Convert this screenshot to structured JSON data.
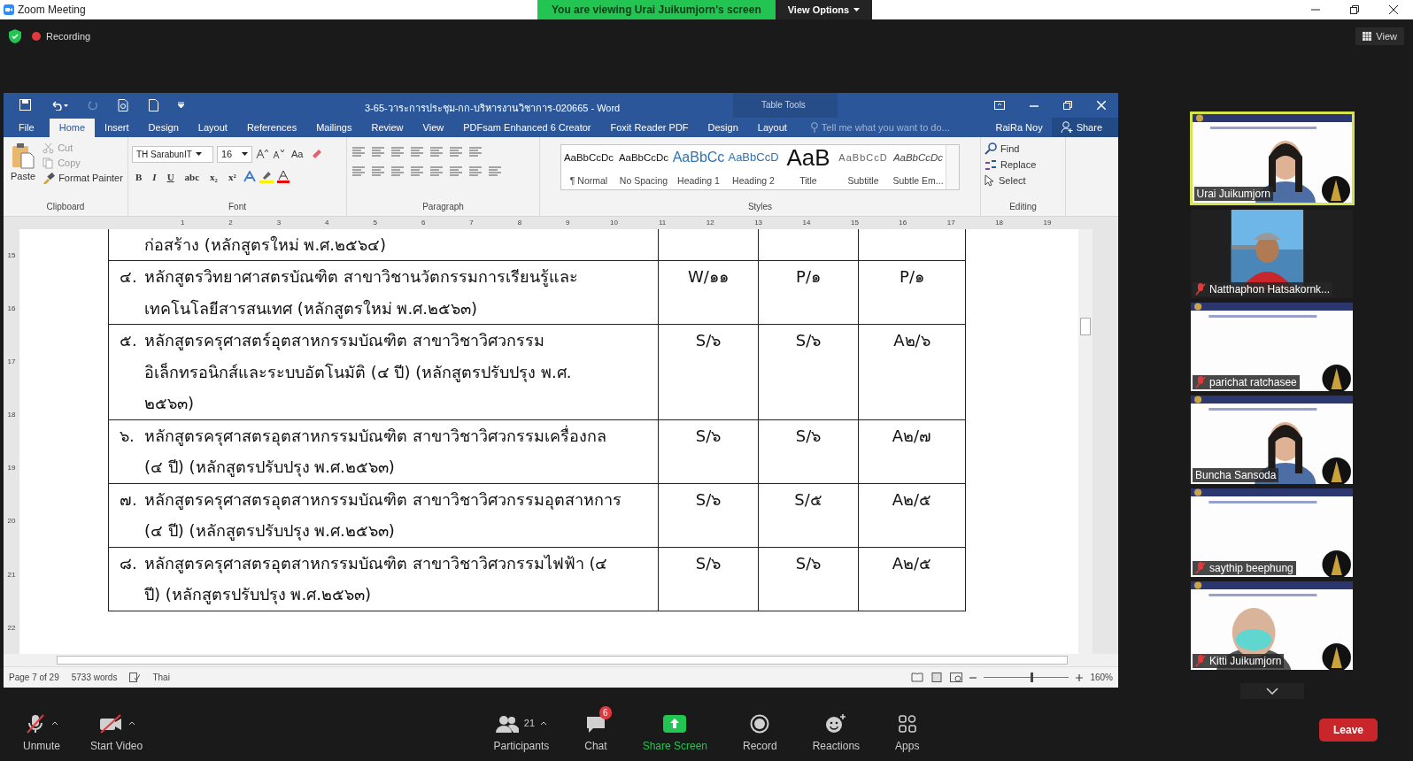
{
  "zoom": {
    "title": "Zoom Meeting",
    "banner": "You are viewing Urai Juikumjorn's screen",
    "view_options": "View Options",
    "recording": "Recording",
    "view": "View"
  },
  "word": {
    "title": "3-65-วาระการประชุม-กก-บริหารงานวิชาการ-020665 - Word",
    "context_label": "Table Tools",
    "tabs": [
      {
        "label": "File",
        "selected": false,
        "kind": "file"
      },
      {
        "label": "Home",
        "selected": true,
        "kind": "main"
      },
      {
        "label": "Insert",
        "selected": false,
        "kind": "main"
      },
      {
        "label": "Design",
        "selected": false,
        "kind": "main"
      },
      {
        "label": "Layout",
        "selected": false,
        "kind": "main"
      },
      {
        "label": "References",
        "selected": false,
        "kind": "main"
      },
      {
        "label": "Mailings",
        "selected": false,
        "kind": "main"
      },
      {
        "label": "Review",
        "selected": false,
        "kind": "main"
      },
      {
        "label": "View",
        "selected": false,
        "kind": "main"
      },
      {
        "label": "PDFsam Enhanced 6 Creator",
        "selected": false,
        "kind": "main"
      },
      {
        "label": "Foxit Reader PDF",
        "selected": false,
        "kind": "main"
      },
      {
        "label": "Design",
        "selected": false,
        "kind": "context"
      },
      {
        "label": "Layout",
        "selected": false,
        "kind": "context"
      }
    ],
    "tell_me": {
      "placeholder": "Tell me what you want to do..."
    },
    "user": "RaiRa Noy",
    "share": "Share",
    "clipboard": {
      "label": "Clipboard",
      "paste": "Paste",
      "items": [
        {
          "label": "Cut",
          "disabled": true,
          "kind": "cut"
        },
        {
          "label": "Copy",
          "disabled": true,
          "kind": "copy"
        },
        {
          "label": "Format Painter",
          "disabled": false,
          "kind": "brush"
        }
      ]
    },
    "font": {
      "label": "Font",
      "family": "TH SarabunIT",
      "size": "16",
      "case_button": "Aa",
      "format_buttons": [
        "B",
        "I",
        "U",
        "abc",
        "x₂",
        "x²"
      ]
    },
    "paragraph": {
      "label": "Paragraph"
    },
    "styles": {
      "label": "Styles",
      "items": [
        {
          "preview": "AaBbCcDc",
          "name": "¶ Normal",
          "kind": "normal"
        },
        {
          "preview": "AaBbCcDc",
          "name": "No Spacing",
          "kind": "normal"
        },
        {
          "preview": "AaBbCc",
          "name": "Heading 1",
          "kind": "heading1"
        },
        {
          "preview": "AaBbCcD",
          "name": "Heading 2",
          "kind": "heading2"
        },
        {
          "preview": "AaB",
          "name": "Title",
          "kind": "title"
        },
        {
          "preview": "AaBbCcD",
          "name": "Subtitle",
          "kind": "subtitle"
        },
        {
          "preview": "AaBbCcDc",
          "name": "Subtle Em...",
          "kind": "emphasis"
        }
      ]
    },
    "editing": {
      "label": "Editing",
      "items": [
        {
          "label": "Find",
          "kind": "find"
        },
        {
          "label": "Replace",
          "kind": "replace"
        },
        {
          "label": "Select",
          "kind": "select"
        }
      ]
    },
    "ruler": [
      "1",
      "2",
      "3",
      "4",
      "5",
      "6",
      "7",
      "8",
      "9",
      "10",
      "11",
      "12",
      "13",
      "14",
      "15",
      "16",
      "17",
      "18",
      "19"
    ],
    "vertical_ruler": [
      "15",
      "16",
      "17",
      "18",
      "19",
      "20",
      "21",
      "22"
    ],
    "document": {
      "rows": [
        {
          "lines": [
            "ก่อสร้าง (หลักสูตรใหม่ พ.ศ.๒๕๖๔)"
          ]
        },
        {
          "number": "๔.",
          "lines": [
            "หลักสูตรวิทยาศาสตรบัณฑิต สาขาวิชานวัตกรรมการเรียนรู้และ",
            "เทคโนโลยีสารสนเทศ (หลักสูตรใหม่ พ.ศ.๒๕๖๓)"
          ],
          "values": [
            "W/๑๑",
            "P/๑",
            "P/๑"
          ]
        },
        {
          "number": "๕.",
          "lines": [
            "หลักสูตรครุศาสตร์อุตสาหกรรมบัณฑิต สาขาวิชาวิศวกรรม",
            "อิเล็กทรอนิกส์และระบบอัตโนมัติ (๔ ปี) (หลักสูตรปรับปรุง พ.ศ.",
            "๒๕๖๓)"
          ],
          "values": [
            "S/๖",
            "S/๖",
            "A๒/๖"
          ]
        },
        {
          "number": "๖.",
          "lines": [
            "หลักสูตรครุศาสตรอุตสาหกรรมบัณฑิต สาขาวิชาวิศวกรรมเครื่องกล",
            "(๔ ปี) (หลักสูตรปรับปรุง พ.ศ.๒๕๖๓)"
          ],
          "values": [
            "S/๖",
            "S/๖",
            "A๒/๗"
          ]
        },
        {
          "number": "๗.",
          "lines": [
            "หลักสูตรครุศาสตรอุตสาหกรรมบัณฑิต สาขาวิชาวิศวกรรมอุตสาหการ",
            "(๔ ปี) (หลักสูตรปรับปรุง พ.ศ.๒๕๖๓)"
          ],
          "values": [
            "S/๖",
            "S/๕",
            "A๒/๕"
          ]
        },
        {
          "number": "๘.",
          "lines": [
            "หลักสูตรครุศาสตรอุตสาหกรรมบัณฑิต สาขาวิชาวิศวกรรมไฟฟ้า (๔",
            "ปี) (หลักสูตรปรับปรุง พ.ศ.๒๕๖๓)"
          ],
          "values": [
            "S/๖",
            "S/๖",
            "A๒/๕"
          ]
        }
      ]
    },
    "status": {
      "page": "Page 7 of 29",
      "words": "5733 words",
      "language": "Thai",
      "zoom": "160%",
      "zoom_slider": {
        "level": 0.55
      }
    }
  },
  "participants": [
    {
      "name": "Urai Juikumjorn",
      "muted": false,
      "speaking": true,
      "kind": "slide_person"
    },
    {
      "name": "Natthaphon Hatsakornk...",
      "muted": true,
      "speaking": false
    },
    {
      "name": "parichat ratchasee",
      "muted": true,
      "speaking": false,
      "kind": "slide"
    },
    {
      "name": "Buncha Sansoda",
      "muted": false,
      "speaking": false,
      "kind": "slide_person"
    },
    {
      "name": "saythip beephung",
      "muted": true,
      "speaking": false,
      "kind": "slide"
    },
    {
      "name": "Kitti Juikumjorn",
      "muted": true,
      "speaking": false,
      "kind": "slide_mask"
    }
  ],
  "toolbar": {
    "left": [
      {
        "label": "Unmute",
        "kind": "mic",
        "caret": true
      },
      {
        "label": "Start Video",
        "kind": "video",
        "caret": true
      }
    ],
    "center": [
      {
        "label": "Participants",
        "kind": "participants",
        "count": "21",
        "caret": true
      },
      {
        "label": "Chat",
        "kind": "chat",
        "badge": "6",
        "caret": false
      },
      {
        "label": "Share Screen",
        "kind": "share",
        "caret": false
      },
      {
        "label": "Record",
        "kind": "record",
        "caret": false
      },
      {
        "label": "Reactions",
        "kind": "reactions",
        "caret": false
      },
      {
        "label": "Apps",
        "kind": "apps",
        "caret": false
      }
    ],
    "leave": "Leave"
  }
}
